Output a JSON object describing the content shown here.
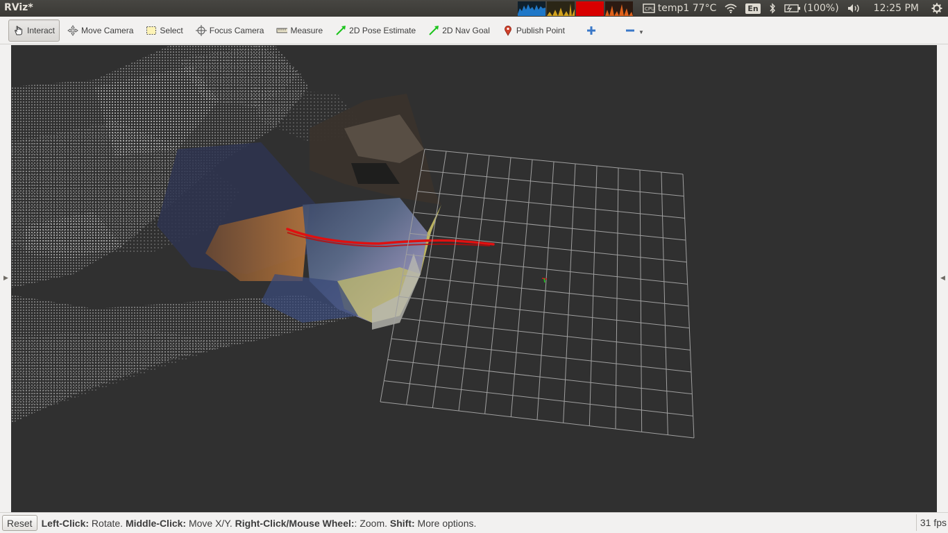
{
  "top_panel": {
    "app_title": "RViz*",
    "temperature": "temp1 77°C",
    "keyboard_layout": "En",
    "battery": "(100%)",
    "clock": "12:25 PM",
    "sysmon_colors": [
      "#1f78c8",
      "#d2a21e",
      "#d80000",
      "#e0621c"
    ]
  },
  "toolbar": {
    "tools": [
      {
        "label": "Interact",
        "icon": "hand-icon",
        "active": true
      },
      {
        "label": "Move Camera",
        "icon": "move-camera-icon",
        "active": false
      },
      {
        "label": "Select",
        "icon": "select-box-icon",
        "active": false
      },
      {
        "label": "Focus Camera",
        "icon": "focus-crosshair-icon",
        "active": false
      },
      {
        "label": "Measure",
        "icon": "ruler-icon",
        "active": false
      },
      {
        "label": "2D Pose Estimate",
        "icon": "green-arrow-icon",
        "active": false
      },
      {
        "label": "2D Nav Goal",
        "icon": "green-arrow-icon",
        "active": false
      },
      {
        "label": "Publish Point",
        "icon": "map-pin-icon",
        "active": false
      }
    ],
    "add_tool_icon": "plus-icon",
    "remove_tool_icon": "minus-icon"
  },
  "viewport": {
    "grid_color": "#a0a0a0",
    "background_color": "#303030",
    "path_color": "#e01010"
  },
  "statusbar": {
    "reset_label": "Reset",
    "help_left_click": "Left-Click:",
    "help_rotate": " Rotate. ",
    "help_middle_click": "Middle-Click:",
    "help_move": " Move X/Y. ",
    "help_right_click": "Right-Click/Mouse Wheel:",
    "help_zoom": ": Zoom. ",
    "help_shift": "Shift:",
    "help_more": " More options.",
    "fps": "31 fps"
  }
}
